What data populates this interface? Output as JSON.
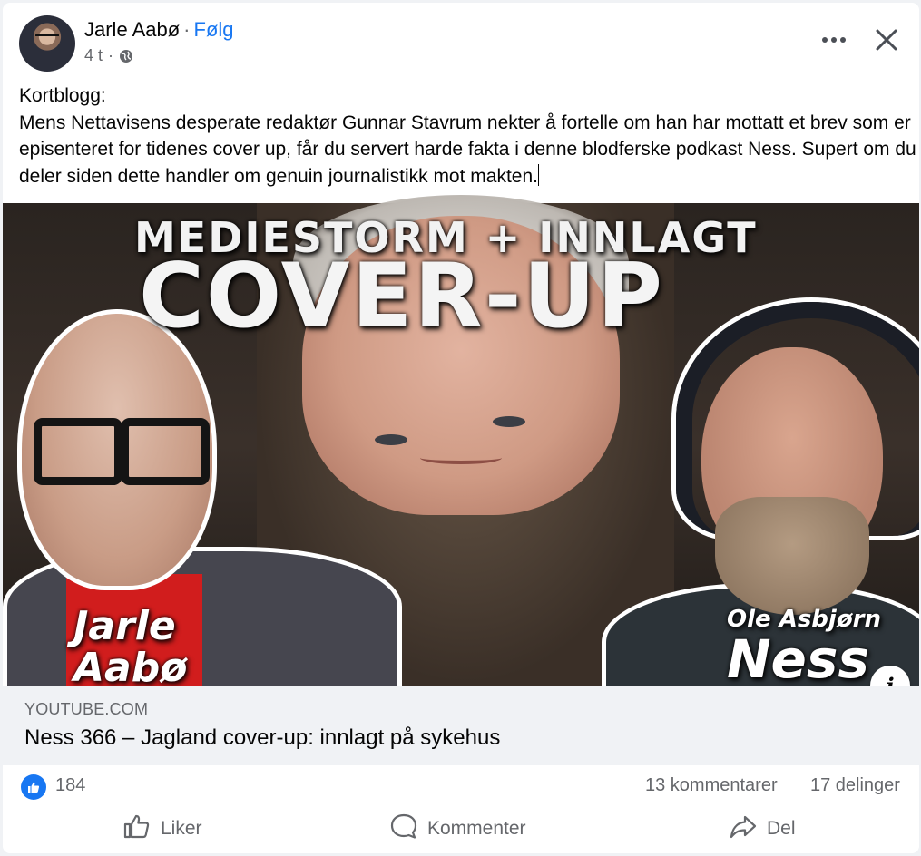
{
  "post": {
    "author": "Jarle Aabø",
    "separator": "·",
    "follow_label": "Følg",
    "time": "4 t",
    "time_separator": "·",
    "privacy_icon": "globe-icon",
    "more_icon": "more-options-icon",
    "close_icon": "close-icon",
    "text": "Kortblogg:\nMens Nettavisens desperate redaktør Gunnar Stavrum nekter å fortelle om han har mottatt et brev som er episenteret for tidenes cover up, får du servert harde fakta i denne blodferske podkast Ness. Supert om du deler siden dette handler om genuin journalistikk mot makten."
  },
  "thumbnail": {
    "headline_top": "MEDIESTORM + INNLAGT",
    "headline_main": "COVER-UP",
    "left_name_line1": "Jarle",
    "left_name_line2": "Aabø",
    "right_name_small": "Ole Asbjørn",
    "right_name_big": "Ness",
    "info_label": "i"
  },
  "link": {
    "domain": "YOUTUBE.COM",
    "title": "Ness 366 – Jagland cover-up: innlagt på sykehus"
  },
  "stats": {
    "reaction_icon": "like-reaction-icon",
    "reactions": "184",
    "comments": "13 kommentarer",
    "shares": "17 delinger"
  },
  "actions": {
    "like": "Liker",
    "comment": "Kommenter",
    "share": "Del"
  },
  "colors": {
    "accent": "#1877f2",
    "muted_text": "#65676b",
    "link_box_bg": "#f0f2f5",
    "shirt_red": "#d11d1d"
  }
}
